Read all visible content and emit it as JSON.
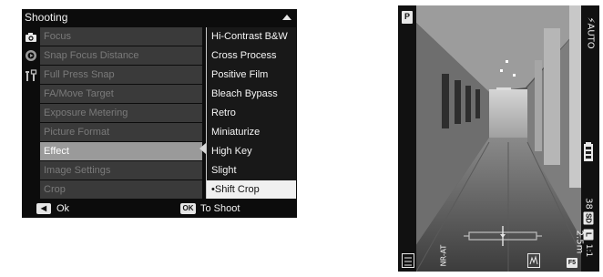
{
  "menu": {
    "title": "Shooting",
    "items": [
      {
        "label": "Focus"
      },
      {
        "label": "Snap Focus Distance"
      },
      {
        "label": "Full Press Snap"
      },
      {
        "label": "FA/Move Target"
      },
      {
        "label": "Exposure Metering"
      },
      {
        "label": "Picture Format"
      },
      {
        "label": "Effect",
        "selected": true
      },
      {
        "label": "Image Settings"
      },
      {
        "label": "Crop"
      }
    ],
    "submenu": [
      {
        "label": "Hi-Contrast B&W"
      },
      {
        "label": "Cross Process"
      },
      {
        "label": "Positive Film"
      },
      {
        "label": "Bleach Bypass"
      },
      {
        "label": "Retro"
      },
      {
        "label": "Miniaturize"
      },
      {
        "label": "High Key"
      },
      {
        "label": "Slight"
      },
      {
        "label": "•Shift Crop",
        "selected": true
      }
    ],
    "sidebar_icons": [
      "camera-icon",
      "play-gear-icon",
      "tools-icon"
    ],
    "footer": {
      "left_key": "◀",
      "left_label": "Ok",
      "right_key": "OK",
      "right_label": "To Shoot"
    }
  },
  "liveview": {
    "mode": "P",
    "flash": "⚡AUTO",
    "battery_icon": "battery-icon",
    "shots_left": "38",
    "storage": "SD",
    "size": "L",
    "aspect": "1:1",
    "focus_distance": "2.5m",
    "fn1": "F5",
    "effect_icon": "shift-crop-icon",
    "nr_label": "NR-AT",
    "colors": {
      "badge": "#e9e9e9",
      "menu_selected": "#9a9a9a"
    }
  }
}
